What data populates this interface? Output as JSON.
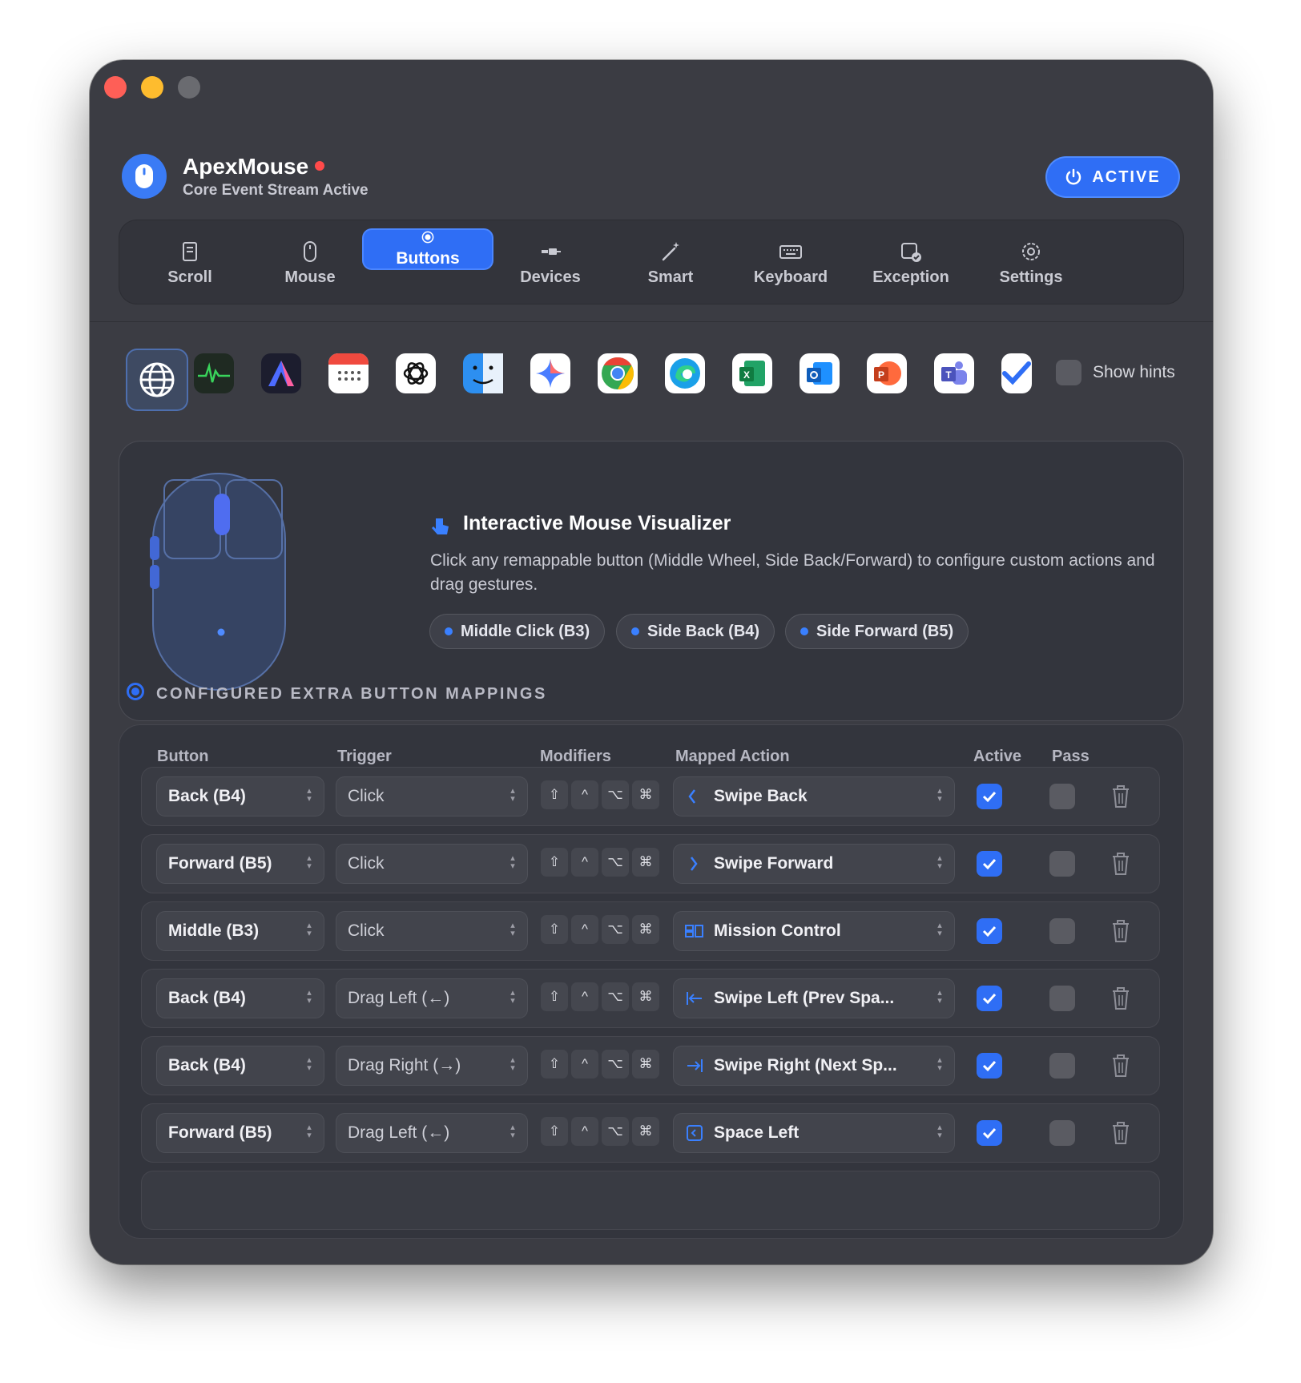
{
  "app": {
    "name": "ApexMouse",
    "subtitle": "Core Event Stream Active",
    "status_button": "ACTIVE"
  },
  "tabs": [
    {
      "label": "Scroll",
      "icon": "scroll-icon"
    },
    {
      "label": "Mouse",
      "icon": "mouse-icon"
    },
    {
      "label": "Buttons",
      "icon": "buttons-icon",
      "selected": true
    },
    {
      "label": "Devices",
      "icon": "devices-icon"
    },
    {
      "label": "Smart",
      "icon": "smart-icon"
    },
    {
      "label": "Keyboard",
      "icon": "keyboard-icon"
    },
    {
      "label": "Exception",
      "icon": "exception-icon"
    },
    {
      "label": "Settings",
      "icon": "settings-icon"
    }
  ],
  "app_icons": [
    "globe-icon",
    "activity-monitor-icon",
    "affinity-icon",
    "calendar-icon",
    "chatgpt-icon",
    "finder-icon",
    "gemini-icon",
    "chrome-icon",
    "edge-icon",
    "excel-icon",
    "outlook-icon",
    "powerpoint-icon",
    "teams-icon",
    "todo-icon"
  ],
  "show_hints": "Show hints",
  "visualizer": {
    "title": "Interactive Mouse Visualizer",
    "description": "Click any remappable button (Middle Wheel, Side Back/Forward) to configure custom actions and drag gestures.",
    "pills": [
      "Middle Click (B3)",
      "Side Back (B4)",
      "Side Forward (B5)"
    ]
  },
  "section_title": "CONFIGURED EXTRA BUTTON MAPPINGS",
  "columns": [
    "Button",
    "Trigger",
    "Modifiers",
    "Mapped Action",
    "Active",
    "Pass"
  ],
  "modifiers": [
    "⇧",
    "^",
    "⌥",
    "⌘"
  ],
  "rows": [
    {
      "button": "Back (B4)",
      "trigger": "Click",
      "action": "Swipe Back",
      "action_icon": "chevron-left-icon",
      "active": true,
      "pass": false
    },
    {
      "button": "Forward (B5)",
      "trigger": "Click",
      "action": "Swipe Forward",
      "action_icon": "chevron-right-icon",
      "active": true,
      "pass": false
    },
    {
      "button": "Middle (B3)",
      "trigger": "Click",
      "action": "Mission Control",
      "action_icon": "mission-control-icon",
      "active": true,
      "pass": false
    },
    {
      "button": "Back (B4)",
      "trigger": "Drag Left (←)",
      "action": "Swipe Left (Prev Spa...",
      "action_icon": "arrow-left-bar-icon",
      "active": true,
      "pass": false
    },
    {
      "button": "Back (B4)",
      "trigger": "Drag Right (→)",
      "action": "Swipe Right (Next Sp...",
      "action_icon": "arrow-right-bar-icon",
      "active": true,
      "pass": false
    },
    {
      "button": "Forward (B5)",
      "trigger": "Drag Left (←)",
      "action": "Space Left",
      "action_icon": "space-left-icon",
      "active": true,
      "pass": false
    }
  ],
  "colors": {
    "accent": "#2f6ef5",
    "window": "#3b3c43",
    "panel": "#33353d"
  }
}
